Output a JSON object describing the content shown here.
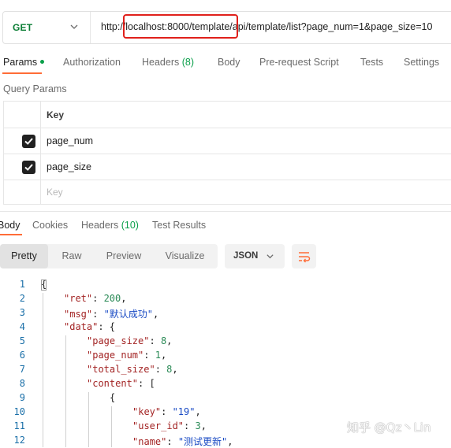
{
  "request": {
    "method": "GET",
    "url": "http://localhost:8000/template/api/template/list?page_num=1&page_size=10"
  },
  "request_tabs": [
    {
      "label": "Params",
      "active": true
    },
    {
      "label": "Authorization"
    },
    {
      "label": "Headers",
      "count": "(8)"
    },
    {
      "label": "Body"
    },
    {
      "label": "Pre-request Script"
    },
    {
      "label": "Tests"
    },
    {
      "label": "Settings"
    }
  ],
  "params": {
    "section_title": "Query Params",
    "header_key": "Key",
    "rows": [
      {
        "key": "page_num",
        "checked": true
      },
      {
        "key": "page_size",
        "checked": true
      }
    ],
    "placeholder_key": "Key"
  },
  "response_tabs": [
    {
      "label": "Body",
      "active": true
    },
    {
      "label": "Cookies"
    },
    {
      "label": "Headers",
      "count": "(10)"
    },
    {
      "label": "Test Results"
    }
  ],
  "view_options": [
    "Pretty",
    "Raw",
    "Preview",
    "Visualize"
  ],
  "format_select": "JSON",
  "line_numbers": [
    "1",
    "2",
    "3",
    "4",
    "5",
    "6",
    "7",
    "8",
    "9",
    "10",
    "11",
    "12"
  ],
  "json_body": {
    "l1": "{",
    "ret_key": "\"ret\"",
    "ret_val": "200",
    "msg_key": "\"msg\"",
    "msg_val": "\"默认成功\"",
    "data_key": "\"data\"",
    "page_size_key": "\"page_size\"",
    "page_size_val": "8",
    "page_num_key": "\"page_num\"",
    "page_num_val": "1",
    "total_size_key": "\"total_size\"",
    "total_size_val": "8",
    "content_key": "\"content\"",
    "l9": "{",
    "key_key": "\"key\"",
    "key_val": "\"19\"",
    "user_id_key": "\"user_id\"",
    "user_id_val": "3",
    "name_key": "\"name\"",
    "name_val": "\"测试更新\""
  },
  "watermark": "知乎 @Qz丶Lin",
  "colors": {
    "accent": "#ff6c37",
    "method_get": "#0a7d34",
    "highlight_box": "#e0201b",
    "count": "#0a9f4a"
  }
}
